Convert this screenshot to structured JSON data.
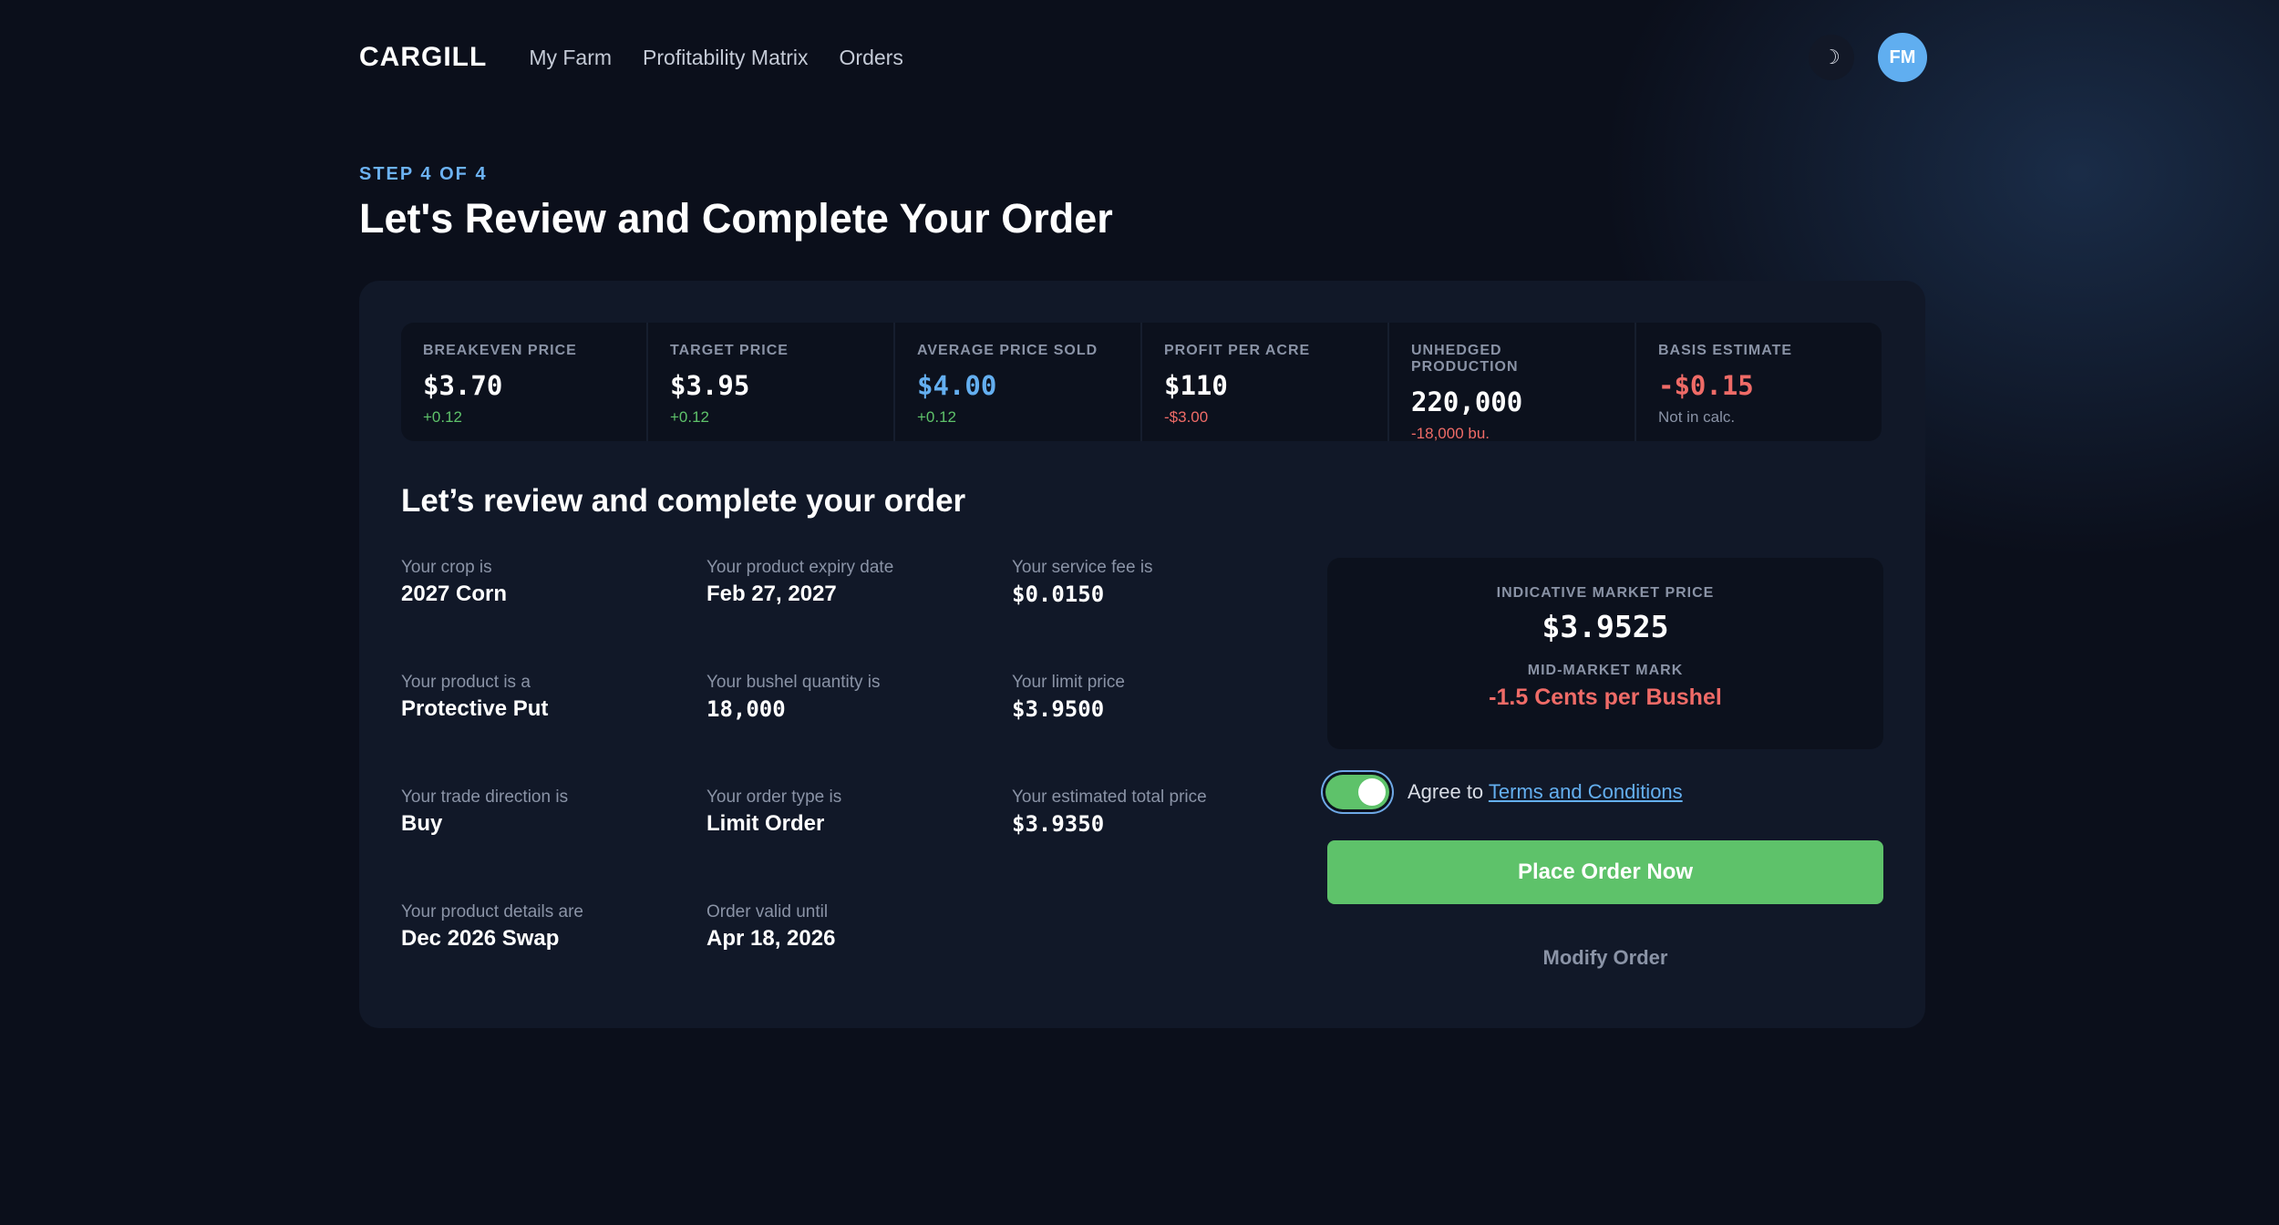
{
  "header": {
    "logo": "CARGILL",
    "nav": [
      "My Farm",
      "Profitability Matrix",
      "Orders"
    ],
    "theme_icon": "moon-icon",
    "theme_glyph": "☽",
    "avatar_initials": "FM"
  },
  "page": {
    "step": "STEP 4 OF 4",
    "title": "Let's Review and Complete Your Order"
  },
  "stats": [
    {
      "label": "BREAKEVEN PRICE",
      "value": "$3.70",
      "delta": "+0.12"
    },
    {
      "label": "TARGET PRICE",
      "value": "$3.95",
      "delta": "+0.12"
    },
    {
      "label": "AVERAGE PRICE SOLD",
      "value": "$4.00",
      "delta": "+0.12"
    },
    {
      "label": "PROFIT PER ACRE",
      "value": "$110",
      "delta": "-$3.00"
    },
    {
      "label": "UNHEDGED PRODUCTION",
      "value": "220,000",
      "delta": "-18,000 bu."
    },
    {
      "label": "BASIS ESTIMATE",
      "value": "-$0.15",
      "delta": "Not in calc."
    }
  ],
  "review": {
    "title": "Let’s review and complete your order",
    "details": [
      {
        "label": "Your crop is",
        "value": "2027 Corn"
      },
      {
        "label": "Your product expiry date",
        "value": "Feb 27, 2027"
      },
      {
        "label": "Your service fee is",
        "value": "$0.0150"
      },
      {
        "label": "Your product is a",
        "value": "Protective Put"
      },
      {
        "label": "Your bushel quantity is",
        "value": "18,000"
      },
      {
        "label": "Your limit price",
        "value": "$3.9500"
      },
      {
        "label": "Your trade direction is",
        "value": "Buy"
      },
      {
        "label": "Your order type is",
        "value": "Limit Order"
      },
      {
        "label": "Your estimated total price",
        "value": "$3.9350"
      },
      {
        "label": "Your product details are",
        "value": "Dec 2026 Swap"
      },
      {
        "label": "Order valid until",
        "value": "Apr 18, 2026"
      }
    ]
  },
  "market": {
    "indicative_label": "INDICATIVE MARKET PRICE",
    "indicative_value": "$3.9525",
    "mid_label": "MID-MARKET MARK",
    "mid_value": "-1.5 Cents per Bushel"
  },
  "agreement": {
    "prefix": "Agree to ",
    "link": "Terms and Conditions",
    "checked": true
  },
  "actions": {
    "place": "Place Order Now",
    "modify": "Modify Order"
  },
  "colors": {
    "accent_blue": "#64aff0",
    "positive": "#5ec26a",
    "negative": "#ef6b67"
  }
}
